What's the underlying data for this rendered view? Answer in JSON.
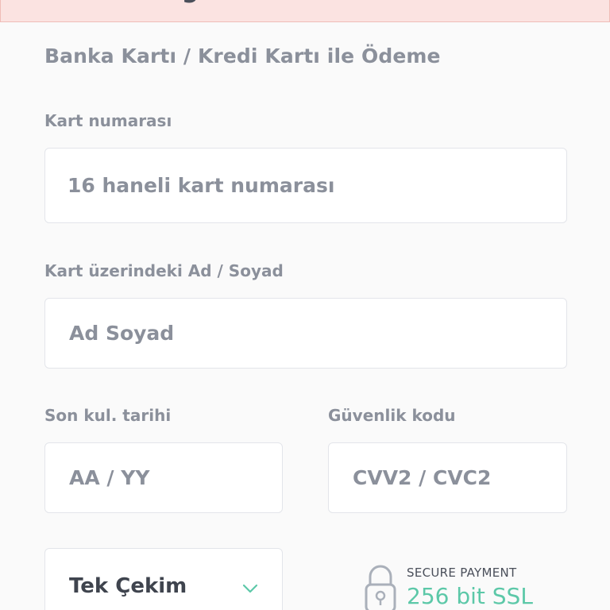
{
  "header": {
    "clipped_heading": "Ödeme Bilgileri"
  },
  "section": {
    "title": "Banka Kartı / Kredi Kartı ile Ödeme"
  },
  "card_number": {
    "label": "Kart numarası",
    "placeholder": "16 haneli kart numarası",
    "value": ""
  },
  "card_holder": {
    "label": "Kart üzerindeki Ad / Soyad",
    "placeholder": "Ad Soyad",
    "value": ""
  },
  "expiry": {
    "label": "Son kul. tarihi",
    "placeholder": "AA / YY",
    "value": ""
  },
  "security_code": {
    "label": "Güvenlik kodu",
    "placeholder": "CVV2 / CVC2",
    "value": ""
  },
  "installment": {
    "selected": "Tek Çekim",
    "icon": "chevron-down-icon"
  },
  "secure_payment": {
    "title": "SECURE PAYMENT",
    "subtitle": "256 bit SSL",
    "icon": "lock-icon"
  },
  "colors": {
    "accent": "#5cc8a8",
    "label": "#8b909b",
    "alert_bg": "#fbe3e1"
  }
}
